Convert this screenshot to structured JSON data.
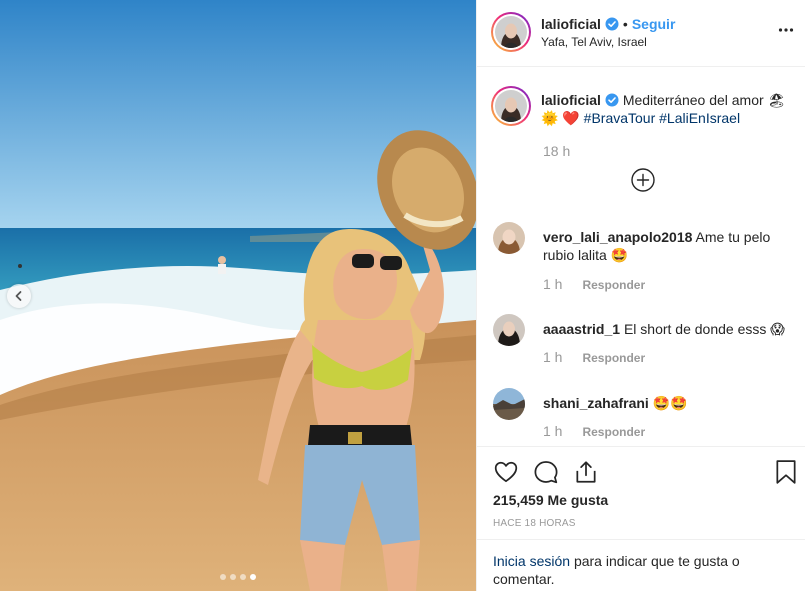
{
  "post": {
    "carousel": {
      "slide_count": 4,
      "active_index": 3
    },
    "author": {
      "username": "lalioficial",
      "verified": true,
      "follow_label": "Seguir",
      "location": "Yafa, Tel Aviv, Israel"
    },
    "caption": {
      "username": "lalioficial",
      "text": "Mediterráneo del amor",
      "emoji": "🏖 🌞 ❤️",
      "hashtags": [
        "#BravaTour",
        "#LaliEnIsrael"
      ],
      "time": "18 h"
    },
    "comments": [
      {
        "username": "vero_lali_anapolo2018",
        "text": "Ame tu pelo rubio lalita 🤩",
        "time": "1 h",
        "reply_label": "Responder"
      },
      {
        "username": "aaaastrid_1",
        "text": "El short de donde esss 😱",
        "time": "1 h",
        "reply_label": "Responder"
      },
      {
        "username": "shani_zahafrani",
        "text": "🤩🤩",
        "time": "1 h",
        "reply_label": "Responder"
      }
    ],
    "likes": "215,459 Me gusta",
    "time_ago": "HACE 18 HORAS",
    "login_prompt": {
      "link": "Inicia sesión",
      "rest": "para indicar que te gusta o comentar."
    }
  },
  "icons": [
    "chevron-left-icon",
    "more-icon",
    "verified-icon",
    "plus-circle-icon",
    "heart-icon",
    "comment-icon",
    "share-icon",
    "bookmark-icon"
  ],
  "colors": {
    "link_blue": "#3897f0",
    "hashtag_blue": "#003569",
    "muted": "#999999",
    "verified": "#3897f0"
  }
}
